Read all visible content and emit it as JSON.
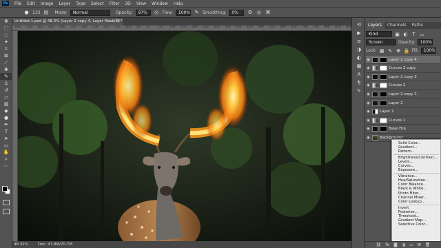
{
  "app": {
    "logo": "Ps"
  },
  "menubar": [
    "File",
    "Edit",
    "Image",
    "Layer",
    "Type",
    "Select",
    "Filter",
    "3D",
    "View",
    "Window",
    "Help"
  ],
  "options": {
    "brush_size": "133",
    "mode_label": "Mode:",
    "mode_value": "Normal",
    "opacity_label": "Opacity:",
    "opacity_value": "97%",
    "flow_label": "Flow:",
    "flow_value": "100%",
    "smoothing_label": "Smoothing:",
    "smoothing_value": "0%"
  },
  "document": {
    "tab_title": "Untitled-1.psd @ 48.3% (Layer 2 copy 4, Layer Mask/8) *",
    "zoom": "48.32%",
    "doc_size": "Doc: 47.8M/70.7M"
  },
  "ruler_ticks": [
    "600",
    "550",
    "500",
    "450",
    "400",
    "350",
    "300",
    "250",
    "200",
    "150",
    "100",
    "50",
    "0",
    "50",
    "100",
    "150",
    "200",
    "250",
    "300",
    "350",
    "400",
    "450",
    "500",
    "550",
    "600",
    "650",
    "700",
    "750",
    "800",
    "850",
    "900"
  ],
  "panels": {
    "tabs": [
      "Layers",
      "Channels",
      "Paths"
    ],
    "kind": "Kind",
    "blend_mode": "Screen",
    "opacity_label": "Opacity:",
    "opacity_value": "100%",
    "lock_label": "Lock:",
    "fill_label": "Fill:",
    "fill_value": "100%"
  },
  "layers": [
    {
      "name": "Layer 2 copy 4",
      "thumb": "dark",
      "mask": "black",
      "selected": true,
      "italic": false
    },
    {
      "name": "Curves 2 copy",
      "thumb": "grad",
      "mask": "white",
      "selected": false,
      "italic": false
    },
    {
      "name": "Layer 2 copy 3",
      "thumb": "dark",
      "mask": "black",
      "selected": false,
      "italic": false
    },
    {
      "name": "Curves 2",
      "thumb": "grad",
      "mask": "white",
      "selected": false,
      "italic": false
    },
    {
      "name": "Layer 2 copy 2",
      "thumb": "dark",
      "mask": "black",
      "selected": false,
      "italic": false
    },
    {
      "name": "Layer 2",
      "thumb": "dark",
      "mask": "black",
      "selected": false,
      "italic": false
    },
    {
      "name": "Layer 1",
      "thumb": "half",
      "mask": "",
      "selected": false,
      "italic": false
    },
    {
      "name": "Curves 1",
      "thumb": "grad",
      "mask": "white",
      "selected": false,
      "italic": false
    },
    {
      "name": "Base Fire",
      "thumb": "dark",
      "mask": "black",
      "selected": false,
      "italic": false
    },
    {
      "name": "Background",
      "thumb": "img",
      "mask": "",
      "selected": false,
      "italic": true
    }
  ],
  "adjustment_menu": [
    [
      "Solid Color...",
      "Gradient...",
      "Pattern..."
    ],
    [
      "Brightness/Contrast...",
      "Levels...",
      "Curves...",
      "Exposure..."
    ],
    [
      "Vibrance...",
      "Hue/Saturation...",
      "Color Balance...",
      "Black & White...",
      "Photo Filter...",
      "Channel Mixer...",
      "Color Lookup..."
    ],
    [
      "Invert",
      "Posterize...",
      "Threshold...",
      "Gradient Map...",
      "Selective Color..."
    ]
  ]
}
